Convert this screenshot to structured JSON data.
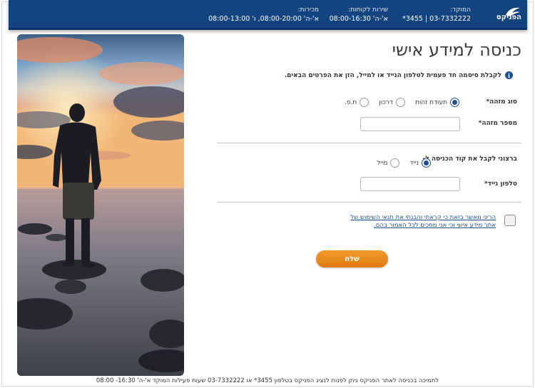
{
  "header": {
    "logo_text": "הפניקס",
    "hotline": {
      "label": "המוקד:",
      "value": "03-7332222 | 3455*"
    },
    "customer_service": {
      "label": "שירות לקוחות:",
      "value": "א'-ה' 08:00-16:30"
    },
    "sales": {
      "label": "מכירות:",
      "value": "א'-ה' 08:00-20:00, ו' 08:00-13:00"
    },
    "colors": {
      "bar": "#14447f",
      "text": "#ffffff"
    }
  },
  "form": {
    "title": "כניסה למידע אישי",
    "info_icon": "info-icon",
    "info_text": "לקבלת סיסמה חד פעמית לטלפון הנייד או למייל, הזן את הפרטים הבאים.",
    "id_type": {
      "label": "סוג מזהה*",
      "options": [
        "תעודת זהות",
        "דרכון",
        "ח.פ."
      ],
      "selected": "תעודת זהות"
    },
    "id_number": {
      "label": "מספר מזהה*",
      "value": "",
      "placeholder": ""
    },
    "delivery": {
      "label": "ברצוני לקבל את קוד הכניסה ל-",
      "options": [
        "נייד",
        "מייל"
      ],
      "selected": "נייד"
    },
    "mobile": {
      "label": "טלפון נייד*",
      "value": "",
      "placeholder": ""
    },
    "terms_text": "הריני מאשר בזאת כי קראתי והבנתי את תנאי השימוש של אתר מידע אישי וכי אני מסכים לכל האמור בהם.",
    "terms_checked": false,
    "submit_label": "שלח",
    "colors": {
      "accent": "#1d4f91",
      "button": "#ee8a1e"
    }
  },
  "footer": {
    "text": "לתמיכה בכניסה לאתר הפניקס ניתן לפנות לנציג הפניקס בטלפון 3455* או 03-7332222 שעות פעילות המוקד א'-ה' 16:30- 08:00"
  }
}
